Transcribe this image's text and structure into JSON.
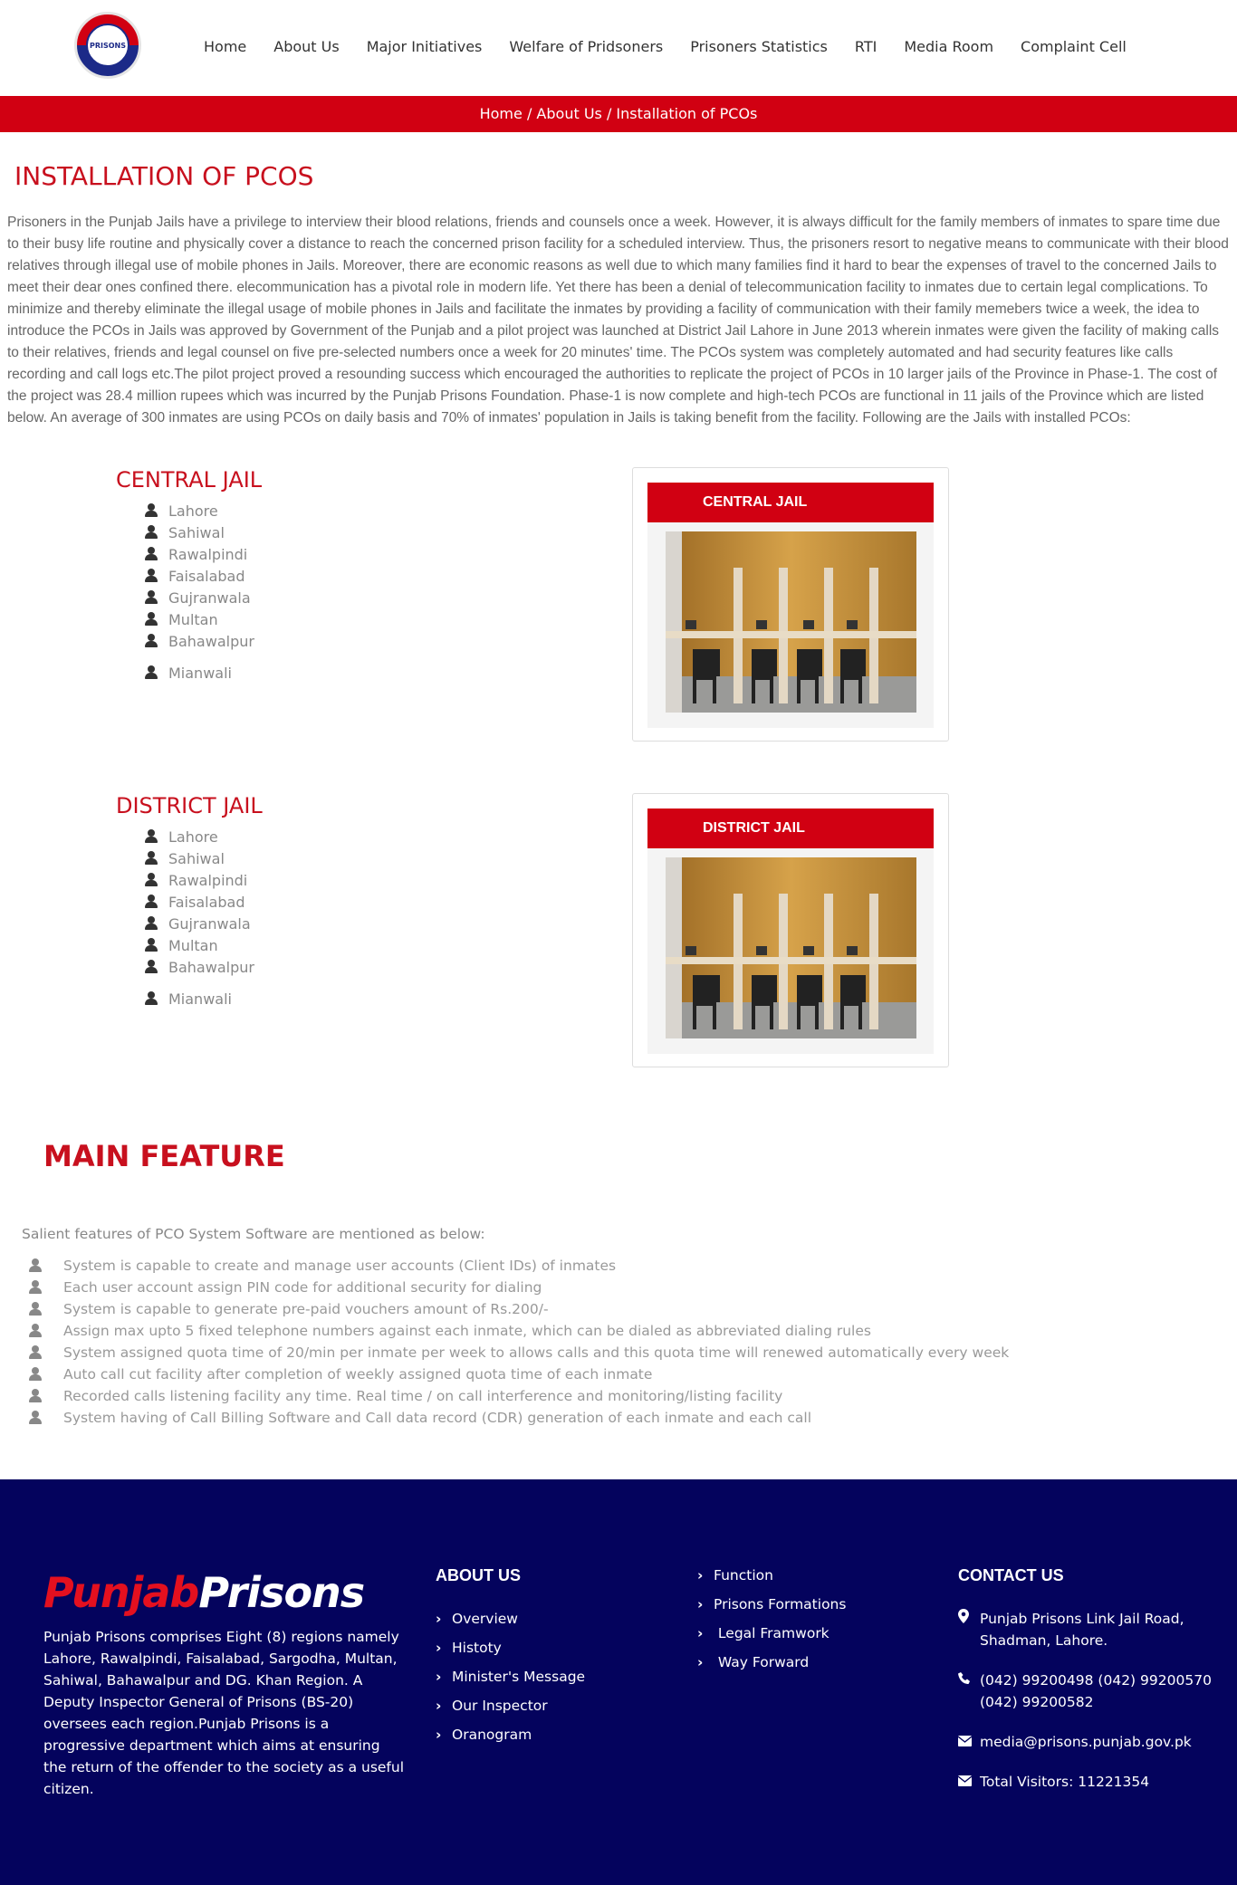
{
  "logo": {
    "text": "PRISONS"
  },
  "nav": [
    "Home",
    "About Us",
    "Major Initiatives",
    "Welfare of Pridsoners",
    "Prisoners Statistics",
    "RTI",
    "Media Room",
    "Complaint Cell"
  ],
  "breadcrumb": "Home / About Us / Installation of PCOs",
  "page_title": "INSTALLATION OF PCOS",
  "intro": "Prisoners in the Punjab Jails have a privilege to interview their blood relations, friends and counsels once a week. However, it is always difficult for the family members of inmates to spare time due to their busy life routine and physically cover a distance to reach the concerned prison facility for a scheduled interview. Thus, the prisoners resort to negative means to communicate with their blood relatives through illegal use of mobile phones in Jails. Moreover, there are economic reasons as well due to which many families find it hard to bear the expenses of travel to the concerned Jails to meet their dear ones confined there. elecommunication has a pivotal role in modern life. Yet there has been a denial of telecommunication facility to inmates due to certain legal complications. To minimize and thereby eliminate the illegal usage of mobile phones in Jails and facilitate the inmates by providing a facility of communication with their family memebers twice a week, the idea to introduce the PCOs in Jails was approved by Government of the Punjab and a pilot project was launched at District Jail Lahore in June 2013 wherein inmates were given the facility of making calls to their relatives, friends and legal counsel on five pre-selected numbers once a week for 20 minutes' time. The PCOs system was completely automated and had security features like calls recording and call logs etc.The pilot project proved a resounding success which encouraged the authorities to replicate the project of PCOs in 10 larger jails of the Province in Phase-1. The cost of the project was 28.4 million rupees which was incurred by the Punjab Prisons Foundation. Phase-1 is now complete and high-tech PCOs are functional in 11 jails of the Province which are listed below. An average of 300 inmates are using PCOs on daily basis and 70% of inmates' population in Jails is taking benefit from the facility. Following are the Jails with installed PCOs:",
  "central": {
    "title": "CENTRAL JAIL",
    "cities": [
      "Lahore",
      "Sahiwal",
      "Rawalpindi",
      "Faisalabad",
      "Gujranwala",
      "Multan",
      "Bahawalpur",
      "Mianwali"
    ],
    "card_title": "CENTRAL JAIL"
  },
  "district": {
    "title": "DISTRICT JAIL",
    "cities": [
      "Lahore",
      "Sahiwal",
      "Rawalpindi",
      "Faisalabad",
      "Gujranwala",
      "Multan",
      "Bahawalpur",
      "Mianwali"
    ],
    "card_title": "DISTRICT JAIL"
  },
  "main_feature": {
    "title": "MAIN FEATURE",
    "intro": "Salient features of PCO System Software are mentioned as below:",
    "items": [
      "System is capable to create and manage user accounts (Client IDs) of inmates",
      "Each user account assign PIN code for additional security for dialing",
      "System is capable to generate pre-paid vouchers amount of Rs.200/-",
      "Assign max upto 5 fixed telephone numbers against each inmate, which can be dialed as abbreviated dialing rules",
      "System assigned quota time of 20/min per inmate per week to allows calls and this quota time will renewed automatically every week",
      "Auto call cut facility after completion of weekly assigned quota time of each inmate",
      "Recorded calls listening facility any time. Real time / on call interference and monitoring/listing facility",
      "System having of Call Billing Software and Call data record (CDR) generation of each inmate and each call"
    ]
  },
  "footer": {
    "brand_red": "Punjab",
    "brand_white": "Prisons",
    "about": "Punjab Prisons comprises Eight (8) regions namely Lahore, Rawalpindi, Faisalabad, Sargodha, Multan, Sahiwal, Bahawalpur and DG. Khan Region. A Deputy Inspector General of Prisons (BS-20) oversees each region.Punjab Prisons is a progressive department which aims at ensuring the return of the offender to the society as a useful citizen.",
    "about_us_title": "ABOUT US",
    "about_us_links": [
      "Overview",
      "Histoty",
      "Minister's Message",
      "Our Inspector",
      "Oranogram"
    ],
    "more_links": [
      "Function",
      "Prisons Formations",
      " Legal Framwork",
      " Way Forward"
    ],
    "contact_title": "CONTACT US",
    "address": "Punjab Prisons Link Jail Road, Shadman, Lahore.",
    "phone": "(042) 99200498 (042) 99200570 (042) 99200582",
    "email": "media@prisons.punjab.gov.pk",
    "visitors": "Total Visitors: 11221354"
  },
  "colors": {
    "brand_red": "#d10012",
    "footer_navy": "#04035d"
  },
  "icons": {
    "list_bullet": "user-icon",
    "footer_link": "chevron-right-icon",
    "address": "map-marker-icon",
    "phone": "phone-icon",
    "email": "envelope-icon"
  }
}
